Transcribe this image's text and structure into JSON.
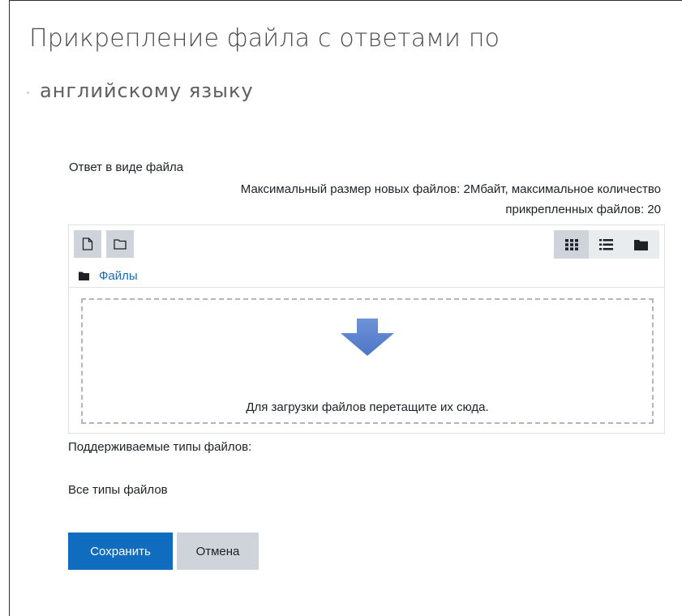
{
  "page": {
    "title_line1": "Прикрепление файла с ответами по",
    "title_line2": "английскому языку"
  },
  "form": {
    "field_label": "Ответ в виде файла",
    "limits_line1": "Максимальный размер новых файлов: 2Мбайт, максимальное количество",
    "limits_line2": "прикрепленных файлов: 20",
    "filemanager": {
      "toolbar": {
        "add_icon": "file-icon",
        "mkdir_icon": "folder-outline-icon",
        "views": [
          {
            "icon": "grid-icon",
            "active": true
          },
          {
            "icon": "list-icon",
            "active": false
          },
          {
            "icon": "folder-tree-icon",
            "active": false
          }
        ]
      },
      "path_label": "Файлы",
      "dropzone_text": "Для загрузки файлов перетащите их сюда."
    },
    "supported_label": "Поддерживаемые типы файлов:",
    "supported_value": "Все типы файлов",
    "save_label": "Сохранить",
    "cancel_label": "Отмена"
  },
  "colors": {
    "primary": "#0f6cbf",
    "secondary": "#ced4da",
    "arrow": "#5b84cf"
  }
}
